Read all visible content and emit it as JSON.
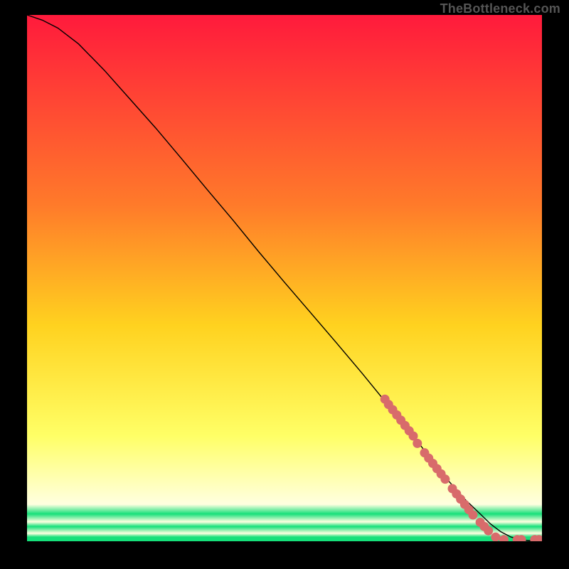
{
  "credit": "TheBottleneck.com",
  "colors": {
    "top": "#ff1a3c",
    "mid1": "#ff7a2a",
    "mid2": "#ffd21f",
    "mid3": "#ffff66",
    "pale": "#ffffe0",
    "green": "#16e07a",
    "line": "#000000",
    "marker": "#d86b6b",
    "frame": "#000000"
  },
  "chart_data": {
    "type": "line",
    "title": "",
    "xlabel": "",
    "ylabel": "",
    "xlim": [
      0,
      100
    ],
    "ylim": [
      0,
      100
    ],
    "curve": {
      "comment": "black decreasing curve; y read as percent of plot height bottom→top",
      "x": [
        0,
        3,
        6,
        10,
        15,
        20,
        25,
        30,
        35,
        40,
        45,
        50,
        55,
        60,
        65,
        70,
        75,
        78,
        80,
        83,
        85,
        88,
        90,
        92,
        94,
        96,
        98,
        100
      ],
      "y": [
        100,
        99,
        97.5,
        94.5,
        89.5,
        84,
        78.5,
        72.7,
        66.8,
        61,
        55,
        49.2,
        43.5,
        37.8,
        32,
        26,
        20,
        16.2,
        13.5,
        10.2,
        8,
        5.2,
        3.3,
        1.8,
        0.8,
        0.25,
        0.1,
        0.1
      ]
    },
    "markers": {
      "comment": "salmon markers along lower-right tail; (x,y) in same percent coords",
      "points": [
        [
          69.5,
          27.0
        ],
        [
          70.2,
          26.0
        ],
        [
          71.0,
          25.0
        ],
        [
          71.8,
          24.0
        ],
        [
          72.6,
          23.0
        ],
        [
          73.4,
          22.0
        ],
        [
          74.2,
          21.0
        ],
        [
          75.0,
          20.0
        ],
        [
          75.8,
          18.6
        ],
        [
          77.2,
          16.8
        ],
        [
          78.0,
          15.8
        ],
        [
          78.8,
          14.8
        ],
        [
          79.6,
          13.8
        ],
        [
          80.4,
          12.8
        ],
        [
          81.2,
          11.8
        ],
        [
          82.6,
          10.0
        ],
        [
          83.4,
          9.0
        ],
        [
          84.2,
          8.0
        ],
        [
          85.0,
          7.0
        ],
        [
          85.8,
          6.0
        ],
        [
          86.6,
          5.0
        ],
        [
          88.0,
          3.6
        ],
        [
          88.8,
          2.8
        ],
        [
          89.6,
          2.0
        ],
        [
          91.0,
          0.8
        ],
        [
          92.6,
          0.3
        ],
        [
          95.2,
          0.3
        ],
        [
          96.0,
          0.3
        ],
        [
          98.6,
          0.3
        ],
        [
          99.4,
          0.3
        ]
      ],
      "radius": 6.5
    },
    "background_gradient_stops": [
      {
        "offset": 0.0,
        "key": "top"
      },
      {
        "offset": 0.36,
        "key": "mid1"
      },
      {
        "offset": 0.59,
        "key": "mid2"
      },
      {
        "offset": 0.8,
        "key": "mid3"
      },
      {
        "offset": 0.93,
        "key": "pale"
      },
      {
        "offset": 0.948,
        "key": "green"
      },
      {
        "offset": 0.963,
        "key": "pale"
      },
      {
        "offset": 0.972,
        "key": "green"
      },
      {
        "offset": 0.985,
        "key": "pale"
      },
      {
        "offset": 0.992,
        "key": "green"
      },
      {
        "offset": 1.0,
        "key": "green"
      }
    ]
  }
}
